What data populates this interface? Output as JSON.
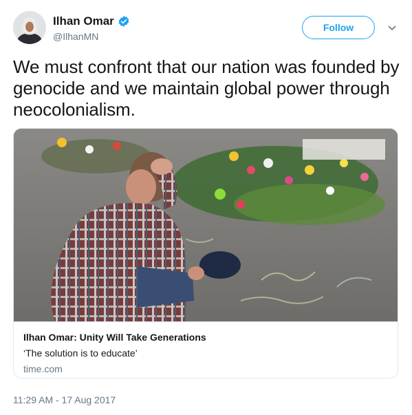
{
  "user": {
    "display_name": "Ilhan Omar",
    "handle": "@IlhanMN",
    "verified_icon": "verified-badge-icon",
    "avatar_icon": "avatar"
  },
  "follow_label": "Follow",
  "menu_icon": "chevron-down-icon",
  "tweet": {
    "text": "We must confront that our nation was founded by genocide and we maintain global power through neocolonialism."
  },
  "card": {
    "title": "Ilhan Omar: Unity Will Take Generations",
    "description": "‘The solution is to educate’",
    "domain": "time.com"
  },
  "timestamp": "11:29 AM - 17 Aug 2017",
  "colors": {
    "accent": "#1da1f2",
    "text": "#14171a",
    "muted": "#657786",
    "border": "#e1e8ed"
  }
}
